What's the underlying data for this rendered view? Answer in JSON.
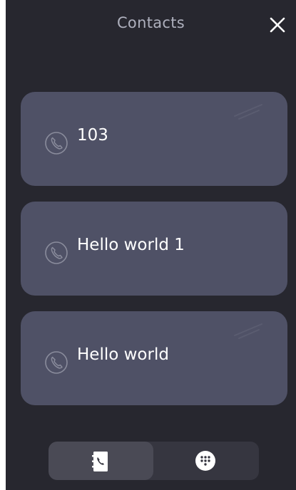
{
  "header": {
    "title": "Contacts"
  },
  "contacts": [
    {
      "name": "103"
    },
    {
      "name": "Hello world 1"
    },
    {
      "name": "Hello world"
    }
  ],
  "icons": {
    "close": "close-icon",
    "call": "phone-icon",
    "contacts_tab": "contact-book-icon",
    "dialpad_tab": "dialpad-icon"
  },
  "colors": {
    "background": "#27272f",
    "card": "#4f5166",
    "tabbar": "#363640",
    "tab_active": "#4a4a55",
    "title_text": "#aeb0bd",
    "primary_text": "#ffffff"
  }
}
